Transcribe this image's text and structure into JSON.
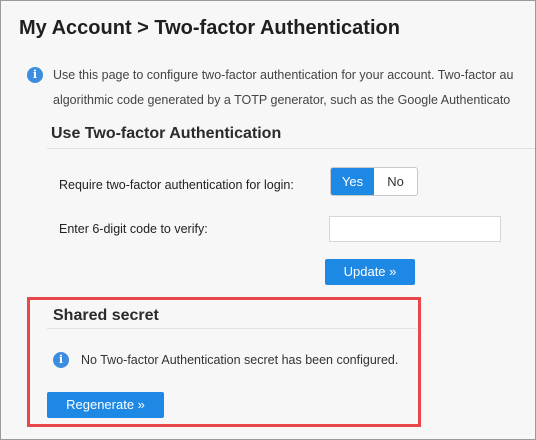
{
  "page": {
    "title": "My Account > Two-factor Authentication"
  },
  "intro": {
    "icon": "info-icon",
    "line1": "Use this page to configure two-factor authentication for your account. Two-factor au",
    "line2": "algorithmic code generated by a TOTP generator, such as the Google Authenticato"
  },
  "use_2fa": {
    "heading": "Use Two-factor Authentication",
    "require_label": "Require two-factor authentication for login:",
    "toggle": {
      "yes": "Yes",
      "no": "No",
      "selected": "Yes"
    },
    "code_label": "Enter 6-digit code to verify:",
    "code_value": "",
    "update_button": "Update »"
  },
  "shared_secret": {
    "heading": "Shared secret",
    "notice_icon": "info-icon",
    "notice": "No Two-factor Authentication secret has been configured.",
    "regenerate_button": "Regenerate »"
  },
  "colors": {
    "accent": "#1e88e5",
    "info_icon": "#3c8de0",
    "highlight": "#e8474c"
  }
}
